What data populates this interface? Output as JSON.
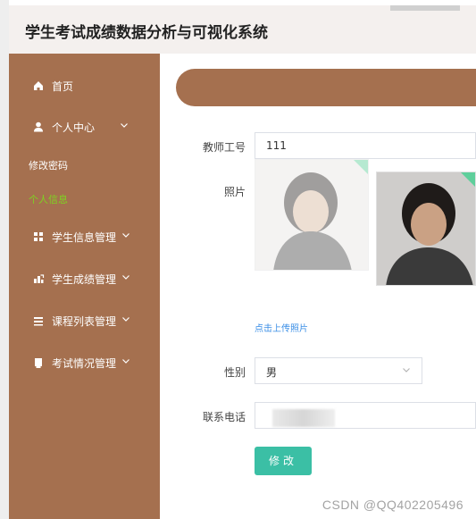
{
  "app": {
    "title": "学生考试成绩数据分析与可视化系统"
  },
  "sidebar": {
    "items": [
      {
        "label": "首页",
        "icon": "home-icon"
      },
      {
        "label": "个人中心",
        "icon": "user-icon",
        "expanded": true
      },
      {
        "label": "学生信息管理",
        "icon": "grid-icon"
      },
      {
        "label": "学生成绩管理",
        "icon": "chart-icon"
      },
      {
        "label": "课程列表管理",
        "icon": "list-icon"
      },
      {
        "label": "考试情况管理",
        "icon": "doc-icon"
      }
    ],
    "sub_items": [
      {
        "label": "修改密码"
      },
      {
        "label": "个人信息",
        "active": true
      }
    ],
    "accent_color": "#a5704f",
    "active_color": "#7ed321"
  },
  "form": {
    "teacher_id": {
      "label": "教师工号",
      "value": "111"
    },
    "photo": {
      "label": "照片",
      "upload_text": "点击上传照片"
    },
    "gender": {
      "label": "性别",
      "value": "男"
    },
    "phone": {
      "label": "联系电话",
      "value": ""
    },
    "submit_label": "修改"
  },
  "watermark": "CSDN @QQ402205496"
}
